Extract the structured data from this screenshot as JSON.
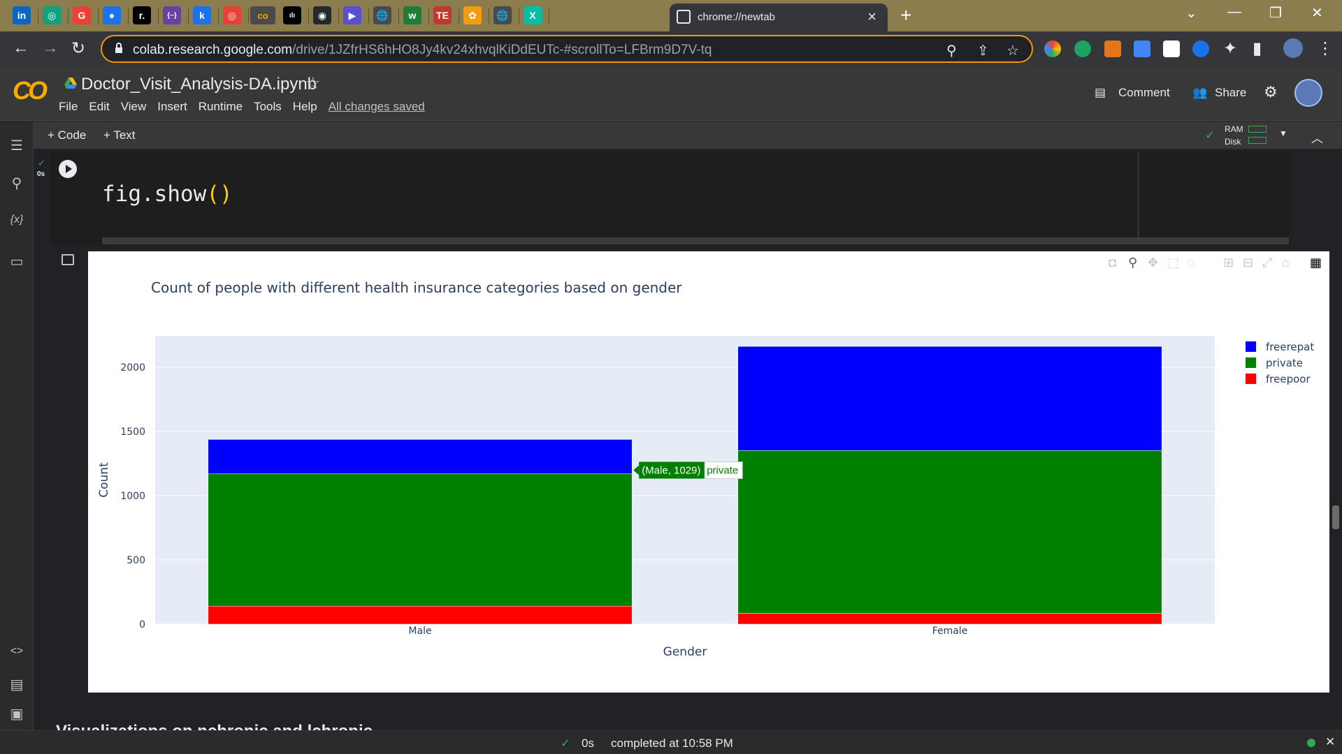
{
  "browser": {
    "active_tab_title": "chrome://newtab",
    "url_host": "colab.research.google.com",
    "url_path": "/drive/1JZfrHS6hHO8Jy4kv24xhvqlKiDdEUTc-#scrollTo=LFBrm9D7V-tq",
    "tab_icons": [
      "in",
      "◎",
      "G",
      "●",
      "r.",
      "{~}",
      "k",
      "◎",
      "co",
      "ılı",
      "◉",
      "▶",
      "🌐",
      "w",
      "TE",
      "✿",
      "🌐",
      "X"
    ]
  },
  "colab": {
    "notebook_title": "Doctor_Visit_Analysis-DA.ipynb",
    "menu": [
      "File",
      "Edit",
      "View",
      "Insert",
      "Runtime",
      "Tools",
      "Help"
    ],
    "saved_status": "All changes saved",
    "comment_label": "Comment",
    "share_label": "Share",
    "add_code_label": "+ Code",
    "add_text_label": "+ Text",
    "ram_label": "RAM",
    "disk_label": "Disk",
    "cell_exec_time": "0s",
    "code_text": "fig.show",
    "code_parens": "()",
    "section_heading": "Visualizations on nchronic and lchronic"
  },
  "status_bar": {
    "elapsed": "0s",
    "completed": "completed at 10:58 PM"
  },
  "colors": {
    "freerepat": "#0000ff",
    "private": "#008000",
    "freepoor": "#ff0000"
  },
  "chart_data": {
    "type": "bar",
    "stacked": true,
    "title": "Count of people with different health insurance categories based on gender",
    "xlabel": "Gender",
    "ylabel": "Count",
    "categories": [
      "Male",
      "Female"
    ],
    "ylim": [
      0,
      2200
    ],
    "yticks": [
      0,
      500,
      1000,
      1500,
      2000
    ],
    "grid": true,
    "legend_position": "right",
    "series": [
      {
        "name": "freepoor",
        "values": [
          140,
          85
        ]
      },
      {
        "name": "private",
        "values": [
          1029,
          1266
        ]
      },
      {
        "name": "freerepat",
        "values": [
          268,
          810
        ]
      }
    ],
    "hover_label": {
      "text": "(Male, 1029)",
      "series": "private"
    }
  }
}
